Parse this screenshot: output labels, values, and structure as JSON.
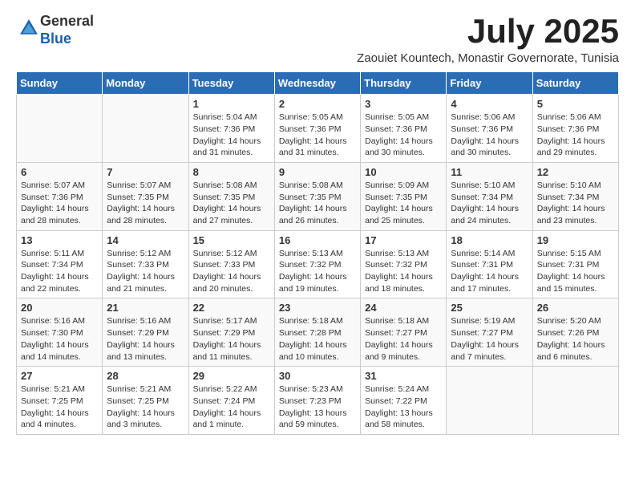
{
  "logo": {
    "general": "General",
    "blue": "Blue"
  },
  "header": {
    "title": "July 2025",
    "subtitle": "Zaouiet Kountech, Monastir Governorate, Tunisia"
  },
  "days_of_week": [
    "Sunday",
    "Monday",
    "Tuesday",
    "Wednesday",
    "Thursday",
    "Friday",
    "Saturday"
  ],
  "weeks": [
    [
      {
        "day": "",
        "info": ""
      },
      {
        "day": "",
        "info": ""
      },
      {
        "day": "1",
        "info": "Sunrise: 5:04 AM\nSunset: 7:36 PM\nDaylight: 14 hours and 31 minutes."
      },
      {
        "day": "2",
        "info": "Sunrise: 5:05 AM\nSunset: 7:36 PM\nDaylight: 14 hours and 31 minutes."
      },
      {
        "day": "3",
        "info": "Sunrise: 5:05 AM\nSunset: 7:36 PM\nDaylight: 14 hours and 30 minutes."
      },
      {
        "day": "4",
        "info": "Sunrise: 5:06 AM\nSunset: 7:36 PM\nDaylight: 14 hours and 30 minutes."
      },
      {
        "day": "5",
        "info": "Sunrise: 5:06 AM\nSunset: 7:36 PM\nDaylight: 14 hours and 29 minutes."
      }
    ],
    [
      {
        "day": "6",
        "info": "Sunrise: 5:07 AM\nSunset: 7:36 PM\nDaylight: 14 hours and 28 minutes."
      },
      {
        "day": "7",
        "info": "Sunrise: 5:07 AM\nSunset: 7:35 PM\nDaylight: 14 hours and 28 minutes."
      },
      {
        "day": "8",
        "info": "Sunrise: 5:08 AM\nSunset: 7:35 PM\nDaylight: 14 hours and 27 minutes."
      },
      {
        "day": "9",
        "info": "Sunrise: 5:08 AM\nSunset: 7:35 PM\nDaylight: 14 hours and 26 minutes."
      },
      {
        "day": "10",
        "info": "Sunrise: 5:09 AM\nSunset: 7:35 PM\nDaylight: 14 hours and 25 minutes."
      },
      {
        "day": "11",
        "info": "Sunrise: 5:10 AM\nSunset: 7:34 PM\nDaylight: 14 hours and 24 minutes."
      },
      {
        "day": "12",
        "info": "Sunrise: 5:10 AM\nSunset: 7:34 PM\nDaylight: 14 hours and 23 minutes."
      }
    ],
    [
      {
        "day": "13",
        "info": "Sunrise: 5:11 AM\nSunset: 7:34 PM\nDaylight: 14 hours and 22 minutes."
      },
      {
        "day": "14",
        "info": "Sunrise: 5:12 AM\nSunset: 7:33 PM\nDaylight: 14 hours and 21 minutes."
      },
      {
        "day": "15",
        "info": "Sunrise: 5:12 AM\nSunset: 7:33 PM\nDaylight: 14 hours and 20 minutes."
      },
      {
        "day": "16",
        "info": "Sunrise: 5:13 AM\nSunset: 7:32 PM\nDaylight: 14 hours and 19 minutes."
      },
      {
        "day": "17",
        "info": "Sunrise: 5:13 AM\nSunset: 7:32 PM\nDaylight: 14 hours and 18 minutes."
      },
      {
        "day": "18",
        "info": "Sunrise: 5:14 AM\nSunset: 7:31 PM\nDaylight: 14 hours and 17 minutes."
      },
      {
        "day": "19",
        "info": "Sunrise: 5:15 AM\nSunset: 7:31 PM\nDaylight: 14 hours and 15 minutes."
      }
    ],
    [
      {
        "day": "20",
        "info": "Sunrise: 5:16 AM\nSunset: 7:30 PM\nDaylight: 14 hours and 14 minutes."
      },
      {
        "day": "21",
        "info": "Sunrise: 5:16 AM\nSunset: 7:29 PM\nDaylight: 14 hours and 13 minutes."
      },
      {
        "day": "22",
        "info": "Sunrise: 5:17 AM\nSunset: 7:29 PM\nDaylight: 14 hours and 11 minutes."
      },
      {
        "day": "23",
        "info": "Sunrise: 5:18 AM\nSunset: 7:28 PM\nDaylight: 14 hours and 10 minutes."
      },
      {
        "day": "24",
        "info": "Sunrise: 5:18 AM\nSunset: 7:27 PM\nDaylight: 14 hours and 9 minutes."
      },
      {
        "day": "25",
        "info": "Sunrise: 5:19 AM\nSunset: 7:27 PM\nDaylight: 14 hours and 7 minutes."
      },
      {
        "day": "26",
        "info": "Sunrise: 5:20 AM\nSunset: 7:26 PM\nDaylight: 14 hours and 6 minutes."
      }
    ],
    [
      {
        "day": "27",
        "info": "Sunrise: 5:21 AM\nSunset: 7:25 PM\nDaylight: 14 hours and 4 minutes."
      },
      {
        "day": "28",
        "info": "Sunrise: 5:21 AM\nSunset: 7:25 PM\nDaylight: 14 hours and 3 minutes."
      },
      {
        "day": "29",
        "info": "Sunrise: 5:22 AM\nSunset: 7:24 PM\nDaylight: 14 hours and 1 minute."
      },
      {
        "day": "30",
        "info": "Sunrise: 5:23 AM\nSunset: 7:23 PM\nDaylight: 13 hours and 59 minutes."
      },
      {
        "day": "31",
        "info": "Sunrise: 5:24 AM\nSunset: 7:22 PM\nDaylight: 13 hours and 58 minutes."
      },
      {
        "day": "",
        "info": ""
      },
      {
        "day": "",
        "info": ""
      }
    ]
  ]
}
